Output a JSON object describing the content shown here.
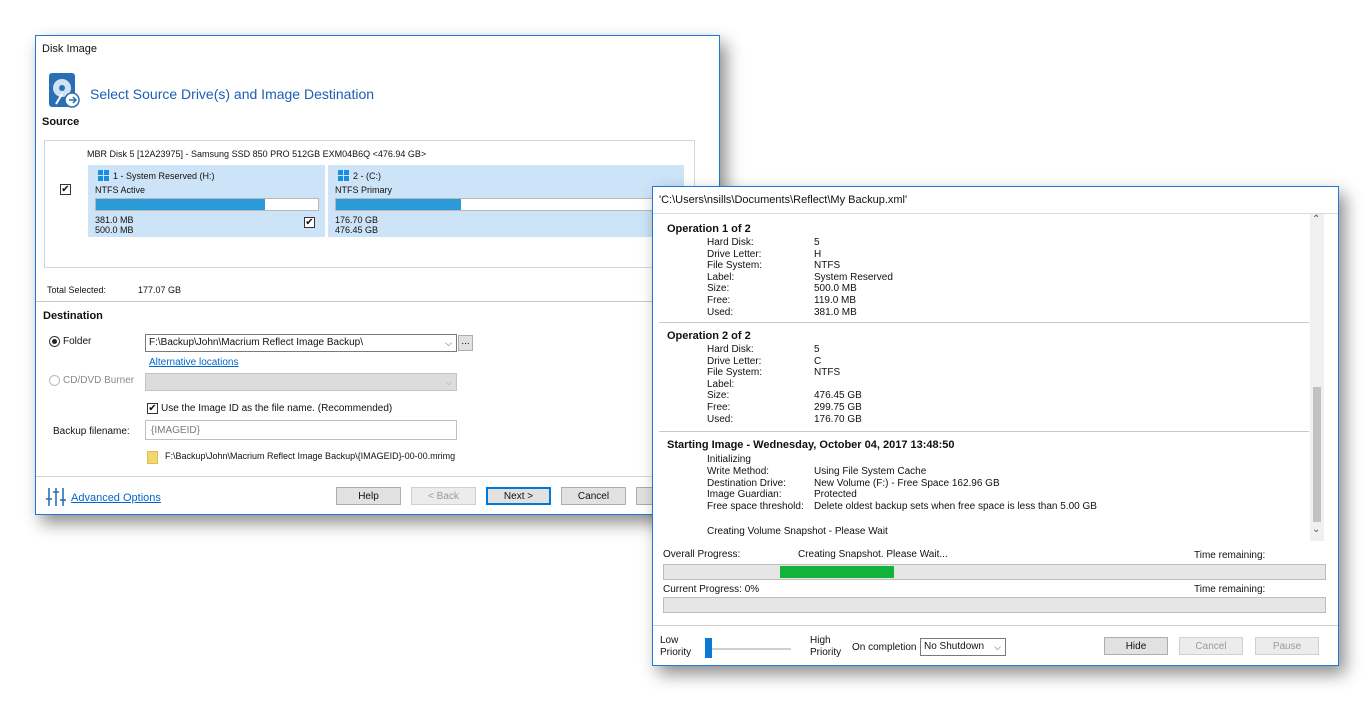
{
  "disk_image": {
    "window_title": "Disk Image",
    "heading": "Select Source Drive(s) and Image Destination",
    "source_label": "Source",
    "disk_label": "MBR Disk 5 [12A23975] - Samsung SSD 850 PRO 512GB EXM04B6Q  <476.94 GB>",
    "partitions": [
      {
        "title": "1 - System Reserved (H:)",
        "fs": "NTFS Active",
        "used": "381.0 MB",
        "total": "500.0 MB",
        "fill": 0.76
      },
      {
        "title": "2 - (C:)",
        "fs": "NTFS Primary",
        "used": "176.70 GB",
        "total": "476.45 GB",
        "fill": 0.37
      }
    ],
    "total_selected_label": "Total Selected:",
    "total_selected_value": "177.07 GB",
    "destination_label": "Destination",
    "folder_label": "Folder",
    "folder_value": "F:\\Backup\\John\\Macrium Reflect Image Backup\\",
    "browse_label": "...",
    "alt_locations": "Alternative locations",
    "cd_label": "CD/DVD Burner",
    "use_image_id": "Use the Image ID as the file name.  (Recommended)",
    "backup_filename_label": "Backup filename:",
    "backup_filename_placeholder": "{IMAGEID}",
    "file_path": "F:\\Backup\\John\\Macrium Reflect Image Backup\\{IMAGEID}-00-00.mrimg",
    "advanced_options": "Advanced Options",
    "buttons": {
      "help": "Help",
      "back": "< Back",
      "next": "Next >",
      "cancel": "Cancel"
    }
  },
  "progress": {
    "title": "'C:\\Users\\nsills\\Documents\\Reflect\\My Backup.xml'",
    "op1": {
      "heading": "Operation 1 of 2",
      "rows": [
        {
          "k": "Hard Disk:",
          "v": "5"
        },
        {
          "k": "Drive Letter:",
          "v": "H"
        },
        {
          "k": "File System:",
          "v": "NTFS"
        },
        {
          "k": "Label:",
          "v": "System Reserved"
        },
        {
          "k": "Size:",
          "v": "500.0 MB"
        },
        {
          "k": "Free:",
          "v": "119.0 MB"
        },
        {
          "k": "Used:",
          "v": "381.0 MB"
        }
      ]
    },
    "op2": {
      "heading": "Operation 2 of 2",
      "rows": [
        {
          "k": "Hard Disk:",
          "v": "5"
        },
        {
          "k": "Drive Letter:",
          "v": "C"
        },
        {
          "k": "File System:",
          "v": "NTFS"
        },
        {
          "k": "Label:",
          "v": ""
        },
        {
          "k": "Size:",
          "v": "476.45 GB"
        },
        {
          "k": "Free:",
          "v": "299.75 GB"
        },
        {
          "k": "Used:",
          "v": "176.70 GB"
        }
      ]
    },
    "start": {
      "heading": "Starting Image - Wednesday, October 04, 2017 13:48:50",
      "initializing": "Initializing",
      "rows": [
        {
          "k": "Write Method:",
          "v": "Using File System Cache"
        },
        {
          "k": "Destination Drive:",
          "v": "New Volume (F:) - Free Space 162.96 GB"
        },
        {
          "k": "Image Guardian:",
          "v": "Protected"
        },
        {
          "k": "Free space threshold:",
          "v": "Delete oldest backup sets when free space is less than 5.00 GB"
        }
      ],
      "snapshot": "Creating Volume Snapshot - Please Wait"
    },
    "overall_label": "Overall Progress:",
    "overall_status": "Creating Snapshot. Please Wait...",
    "time_remaining": "Time remaining:",
    "current_label": "Current Progress:  0%",
    "low_priority": "Low\nPriority",
    "high_priority": "High\nPriority",
    "on_completion": "On completion",
    "completion_value": "No Shutdown",
    "buttons": {
      "hide": "Hide",
      "cancel": "Cancel",
      "pause": "Pause"
    }
  }
}
